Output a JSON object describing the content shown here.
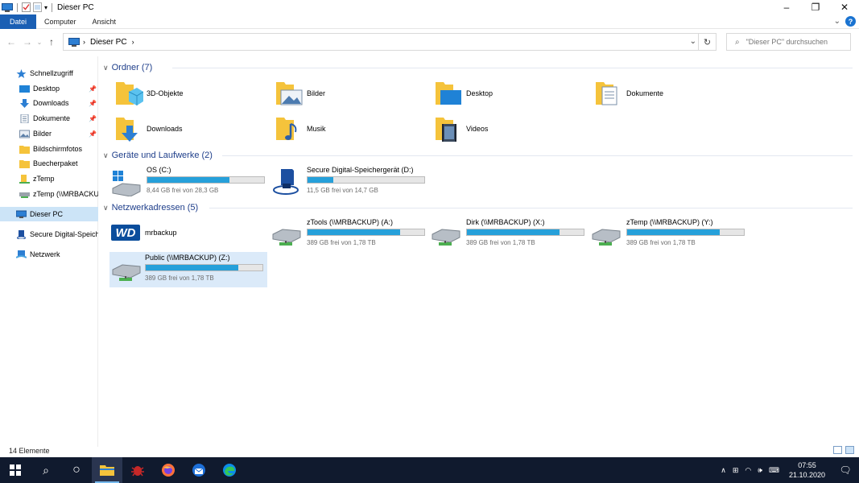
{
  "window": {
    "title": "Dieser PC",
    "tabs": [
      "Datei",
      "Computer",
      "Ansicht"
    ]
  },
  "address": {
    "location": "Dieser PC",
    "search_placeholder": "\"Dieser PC\" durchsuchen"
  },
  "nav": {
    "quick_access": "Schnellzugriff",
    "items": [
      {
        "label": "Desktop",
        "pinned": true
      },
      {
        "label": "Downloads",
        "pinned": true
      },
      {
        "label": "Dokumente",
        "pinned": true
      },
      {
        "label": "Bilder",
        "pinned": true
      },
      {
        "label": "Bildschirmfotos",
        "pinned": false
      },
      {
        "label": "Buecherpaket",
        "pinned": false
      },
      {
        "label": "zTemp",
        "pinned": false
      },
      {
        "label": "zTemp (\\\\MRBACKUP) (Y:)",
        "pinned": false
      }
    ],
    "this_pc": "Dieser PC",
    "sd_device": "Secure Digital-Speichergerät (D:)",
    "network": "Netzwerk"
  },
  "groups": {
    "folders": "Ordner (7)",
    "drives": "Geräte und Laufwerke (2)",
    "network": "Netzwerkadressen (5)"
  },
  "folders": [
    "3D-Objekte",
    "Bilder",
    "Desktop",
    "Dokumente",
    "Downloads",
    "Musik",
    "Videos"
  ],
  "drives": [
    {
      "name": "OS (C:)",
      "free": "8,44 GB frei von 28,3 GB",
      "used_fraction": 0.7
    },
    {
      "name": "Secure Digital-Speichergerät (D:)",
      "free": "11,5 GB frei von 14,7 GB",
      "used_fraction": 0.22
    }
  ],
  "network_locations": [
    {
      "name": "mrbackup"
    },
    {
      "name": "zTools (\\\\MRBACKUP) (A:)",
      "free": "389 GB frei von 1,78 TB",
      "used_fraction": 0.79
    },
    {
      "name": "Dirk (\\\\MRBACKUP) (X:)",
      "free": "389 GB frei von 1,78 TB",
      "used_fraction": 0.79
    },
    {
      "name": "zTemp (\\\\MRBACKUP) (Y:)",
      "free": "389 GB frei von 1,78 TB",
      "used_fraction": 0.79
    },
    {
      "name": "Public (\\\\MRBACKUP) (Z:)",
      "free": "389 GB frei von 1,78 TB",
      "used_fraction": 0.79
    }
  ],
  "wd_logo": "WD",
  "status": {
    "count": "14 Elemente"
  },
  "taskbar": {
    "time": "07:55",
    "date": "21.10.2020"
  },
  "colors": {
    "accent": "#1a5fb4",
    "bar_fill": "#26a0da",
    "taskbar": "#101a2e"
  }
}
